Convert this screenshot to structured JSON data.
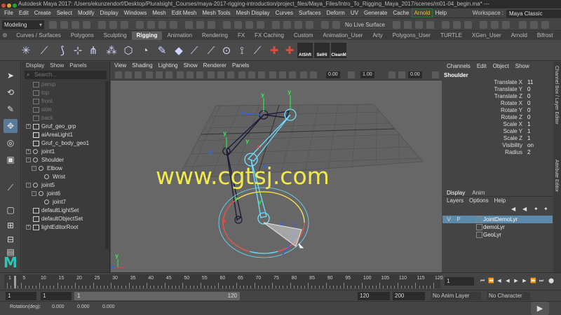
{
  "window": {
    "title": "Autodesk Maya 2017: /Users/ekunzendorf/Desktop/Pluralsight_Courses/maya-2017-rigging-introduction/project_files/Maya_Files/Intro_To_Rigging_Maya_2017/scenes/m01-04_begin.ma* ---"
  },
  "menubar": {
    "items": [
      "File",
      "Edit",
      "Create",
      "Select",
      "Modify",
      "Display",
      "Windows",
      "Mesh",
      "Edit Mesh",
      "Mesh Tools",
      "Mesh Display",
      "Curves",
      "Surfaces",
      "Deform",
      "UV",
      "Generate",
      "Cache",
      "Arnold",
      "Help"
    ],
    "workspace_label": "Workspace :",
    "workspace_value": "Maya Classic"
  },
  "statusline": {
    "mode": "Modeling",
    "live_surface": "No Live Surface"
  },
  "shelf": {
    "tabs": [
      "Curves / Surfaces",
      "Polygons",
      "Sculpting",
      "Rigging",
      "Animation",
      "Rendering",
      "FX",
      "FX Caching",
      "Custom",
      "Animation_User",
      "Arty",
      "Polygons_User",
      "TURTLE",
      "XGen_User",
      "Arnold",
      "Bifrost"
    ],
    "active_tab": "Rigging",
    "buttons": [
      "AtShft",
      "SelHi",
      "CleanM"
    ]
  },
  "outliner": {
    "menu": [
      "Display",
      "Show",
      "Panels"
    ],
    "search_placeholder": "Search...",
    "items": [
      {
        "label": "persp",
        "indent": 0,
        "expand": "",
        "dim": true,
        "icon": "camera"
      },
      {
        "label": "top",
        "indent": 0,
        "expand": "",
        "dim": true,
        "icon": "camera"
      },
      {
        "label": "front",
        "indent": 0,
        "expand": "",
        "dim": true,
        "icon": "camera"
      },
      {
        "label": "side",
        "indent": 0,
        "expand": "",
        "dim": true,
        "icon": "camera"
      },
      {
        "label": "back",
        "indent": 0,
        "expand": "",
        "dim": true,
        "icon": "camera"
      },
      {
        "label": "Gruf_geo_grp",
        "indent": 0,
        "expand": "+",
        "dim": false,
        "icon": "group"
      },
      {
        "label": "aiAreaLight1",
        "indent": 0,
        "expand": "",
        "dim": false,
        "icon": "light"
      },
      {
        "label": "Gruf_c_body_geo1",
        "indent": 0,
        "expand": "",
        "dim": false,
        "icon": "mesh"
      },
      {
        "label": "joint1",
        "indent": 0,
        "expand": "+",
        "dim": false,
        "icon": "joint"
      },
      {
        "label": "Shoulder",
        "indent": 0,
        "expand": "-",
        "dim": false,
        "icon": "joint"
      },
      {
        "label": "Elbow",
        "indent": 1,
        "expand": "-",
        "dim": false,
        "icon": "joint"
      },
      {
        "label": "Wrist",
        "indent": 2,
        "expand": "",
        "dim": false,
        "icon": "joint"
      },
      {
        "label": "joint5",
        "indent": 0,
        "expand": "-",
        "dim": false,
        "icon": "joint"
      },
      {
        "label": "joint6",
        "indent": 1,
        "expand": "-",
        "dim": false,
        "icon": "joint"
      },
      {
        "label": "joint7",
        "indent": 2,
        "expand": "",
        "dim": false,
        "icon": "joint"
      },
      {
        "label": "defaultLightSet",
        "indent": 0,
        "expand": "",
        "dim": false,
        "icon": "set"
      },
      {
        "label": "defaultObjectSet",
        "indent": 0,
        "expand": "",
        "dim": false,
        "icon": "set"
      },
      {
        "label": "lightEditorRoot",
        "indent": 0,
        "expand": "+",
        "dim": false,
        "icon": "set"
      }
    ]
  },
  "viewport": {
    "menu": [
      "View",
      "Shading",
      "Lighting",
      "Show",
      "Renderer",
      "Panels"
    ],
    "field_value_1": "0.00",
    "field_value_2": "1.00",
    "exposure_value": "0.00",
    "camera_label": "persp",
    "overlay_text": "www.cgtsj.com"
  },
  "channel_box": {
    "tabs": [
      "Channels",
      "Edit",
      "Object",
      "Show"
    ],
    "object": "Shoulder",
    "attributes": [
      {
        "name": "Translate X",
        "value": "11"
      },
      {
        "name": "Translate Y",
        "value": "0"
      },
      {
        "name": "Translate Z",
        "value": "0"
      },
      {
        "name": "Rotate X",
        "value": "0"
      },
      {
        "name": "Rotate Y",
        "value": "0"
      },
      {
        "name": "Rotate Z",
        "value": "0"
      },
      {
        "name": "Scale X",
        "value": "1"
      },
      {
        "name": "Scale Y",
        "value": "1"
      },
      {
        "name": "Scale Z",
        "value": "1"
      },
      {
        "name": "Visibility",
        "value": "on"
      },
      {
        "name": "Radius",
        "value": "2"
      }
    ]
  },
  "layers": {
    "tabs": [
      "Display",
      "Anim"
    ],
    "active_tab": "Display",
    "menu": [
      "Layers",
      "Options",
      "Help"
    ],
    "rows": [
      {
        "v": "V",
        "p": "P",
        "name": "JointDemoLyr",
        "highlight": true
      },
      {
        "v": "",
        "p": "",
        "name": "demoLyr",
        "highlight": false
      },
      {
        "v": "",
        "p": "",
        "name": "GeoLyr",
        "highlight": false
      }
    ]
  },
  "side_tabs": [
    "Channel Box / Layer Editor",
    "Attribute Editor"
  ],
  "timeline": {
    "ticks": [
      "1",
      "5",
      "10",
      "15",
      "20",
      "25",
      "30",
      "35",
      "40",
      "45",
      "50",
      "55",
      "60",
      "65",
      "70",
      "75",
      "80",
      "85",
      "90",
      "95",
      "100",
      "105",
      "110",
      "115",
      "120"
    ],
    "current_frame": "1"
  },
  "range": {
    "start": "1",
    "anim_start": "1",
    "slider_left": "1",
    "slider_right": "120",
    "end": "120",
    "anim_end": "200",
    "anim_layer": "No Anim Layer",
    "char_set": "No Character Set"
  },
  "command": {
    "label": "Rotation(deg):",
    "x": "0.000",
    "y": "0.000",
    "z": "0.000"
  }
}
